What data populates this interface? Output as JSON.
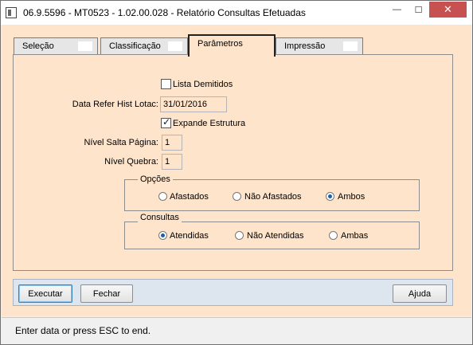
{
  "window": {
    "title": "06.9.5596 - MT0523 - 1.02.00.028 - Relatório Consultas Efetuadas",
    "minimize_glyph": "—",
    "maximize_glyph": "☐",
    "close_glyph": "✕"
  },
  "tabs": [
    {
      "label": "Seleção",
      "active": false
    },
    {
      "label": "Classificação",
      "active": false
    },
    {
      "label": "Parâmetros",
      "active": true
    },
    {
      "label": "Impressão",
      "active": false
    }
  ],
  "params": {
    "lista_demitidos": {
      "label": "Lista Demitidos",
      "checked": false
    },
    "data_refer": {
      "label": "Data Refer Hist Lotac:",
      "value": "31/01/2016"
    },
    "expande_estrutura": {
      "label": "Expande Estrutura",
      "checked": true
    },
    "nivel_salta": {
      "label": "Nível Salta Página:",
      "value": "1"
    },
    "nivel_quebra": {
      "label": "Nível Quebra:",
      "value": "1"
    }
  },
  "opcoes": {
    "title": "Opções",
    "options": [
      "Afastados",
      "Não Afastados",
      "Ambos"
    ],
    "selected": "Ambos"
  },
  "consultas": {
    "title": "Consultas",
    "options": [
      "Atendidas",
      "Não Atendidas",
      "Ambas"
    ],
    "selected": "Atendidas"
  },
  "buttons": {
    "executar": "Executar",
    "fechar": "Fechar",
    "ajuda": "Ajuda"
  },
  "status": {
    "text": "Enter data or press ESC to end."
  },
  "colors": {
    "panel_bg": "#ffe4cc",
    "button_bar_bg": "#dde5ee",
    "close_button": "#c75050"
  }
}
